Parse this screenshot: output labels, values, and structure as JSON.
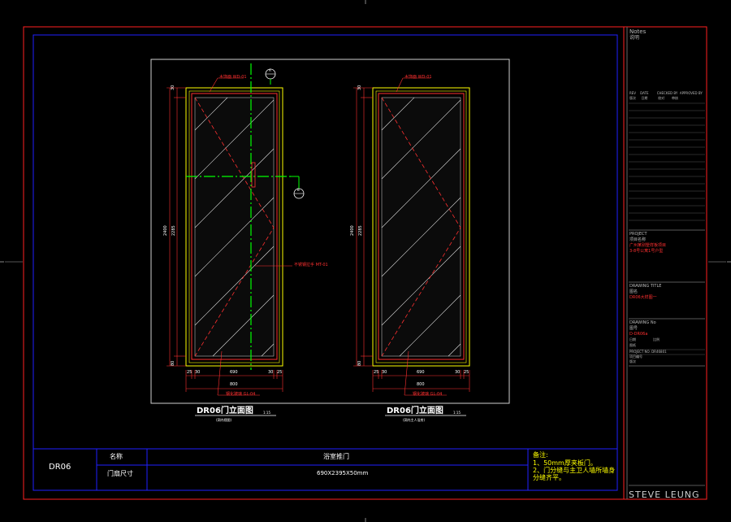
{
  "elevations": [
    {
      "title": "DR06门立面图",
      "scale": "1:15",
      "subtitle": "(洞内视图)",
      "dims": {
        "total_height": "2400",
        "inner_height": "2285",
        "top": "30",
        "top2": "25",
        "bottom": "80",
        "bottom_width": "800",
        "inner_width": "690",
        "left_a": "25",
        "left_b": "30",
        "right_a": "30",
        "right_b": "25"
      },
      "callouts": [
        {
          "text": "木饰面",
          "code": "WD-01"
        },
        {
          "text": "不锈钢拉手",
          "code": "MT-01"
        },
        {
          "text": "钢化玻璃",
          "code": "GL-04"
        }
      ],
      "markers": [
        "A",
        "B"
      ]
    },
    {
      "title": "DR06门立面图",
      "scale": "1:15",
      "subtitle": "(洞内主人浴房)",
      "dims": {
        "total_height": "2400",
        "inner_height": "2285",
        "top": "30",
        "top2": "25",
        "bottom": "80",
        "bottom_width": "800",
        "inner_width": "690",
        "left_a": "25",
        "left_b": "30",
        "right_a": "30",
        "right_b": "25"
      },
      "callouts": [
        {
          "text": "木饰面",
          "code": "WD-01"
        },
        {
          "text": "钢化玻璃",
          "code": "GL-04"
        }
      ],
      "markers": []
    }
  ],
  "schedule": {
    "code": "DR06",
    "name_label": "名称",
    "name_value": "浴室推门",
    "size_label": "门扇尺寸",
    "size_value": "690X2395X50mm",
    "notes_title": "备注:",
    "notes": [
      "1、50mm厚夹板门。",
      "2、门分缝与主卫人墙所墙身",
      "   分缝齐平。"
    ]
  },
  "title_block": {
    "notes_en": "Notes",
    "notes_cn": "说明",
    "rev_headers": [
      "REV",
      "DATE",
      "CHECKED BY",
      "APPROVED BY"
    ],
    "rev_headers_cn": [
      "版次",
      "日期",
      "校对",
      "审核"
    ],
    "project_en": "PROJECT",
    "project_cn": "项目名称",
    "project_lines": [
      "广州某别墅样板项目",
      "3-8号公寓1号户型"
    ],
    "drawing_title_en": "DRAWING TITLE",
    "drawing_title_cn": "图名",
    "drawing_title_value": "DR06大样图一",
    "drawing_no_en": "DRAWING No",
    "drawing_no_cn": "图号",
    "drawing_no_value": "D-DR06a",
    "small_labels": [
      "日期",
      "比例",
      "图纸",
      "项目编号",
      "版次"
    ],
    "project_no_label": "PROJECT NO.",
    "project_no_value": "DR46801",
    "brand": "STEVE LEUNG"
  }
}
